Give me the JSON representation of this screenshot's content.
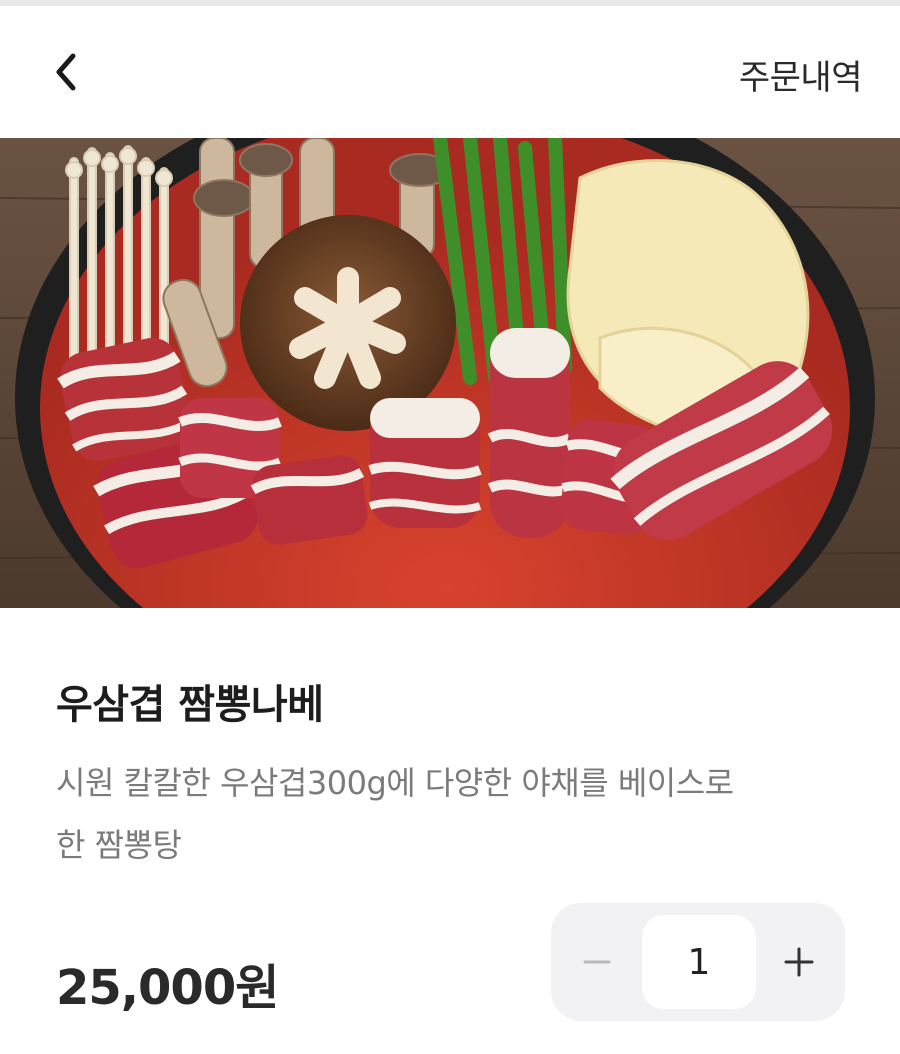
{
  "header": {
    "back_icon": "chevron-left-icon",
    "order_history_label": "주문내역"
  },
  "hero_image": {
    "subject": "hot pot with beef brisket, mushrooms, green onions and napa cabbage in spicy red broth"
  },
  "product": {
    "name": "우삼겹 짬뽕나베",
    "description": "시원 칼칼한 우삼겹300g에 다양한 야채를 베이스로 한 짬뽕탕",
    "price": "25,000원"
  },
  "quantity_stepper": {
    "minus_icon": "minus-icon",
    "plus_icon": "plus-icon",
    "value": "1"
  },
  "colors": {
    "broth": "#c2372a",
    "wood": "#5a4535",
    "pot": "#1f1f1f",
    "text_primary": "#1d1d1d",
    "text_secondary": "#7b7b7b",
    "stepper_bg": "#f2f2f4"
  }
}
